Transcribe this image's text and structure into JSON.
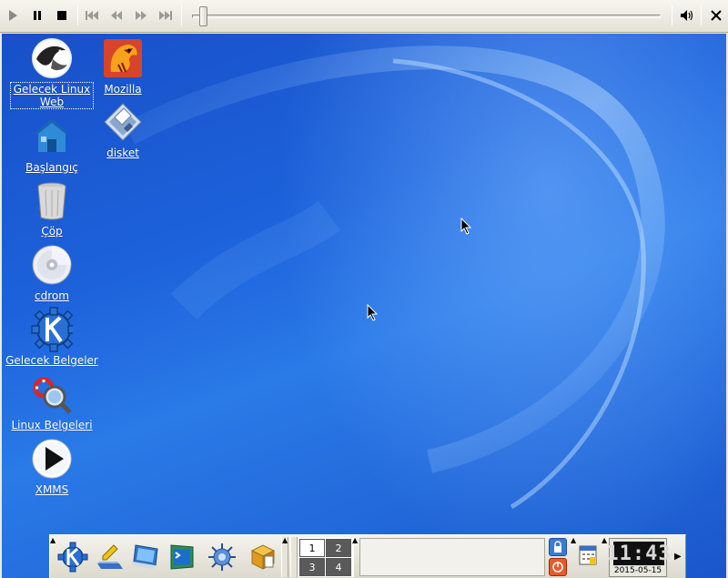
{
  "media_bar": {
    "buttons": [
      "play-icon",
      "pause-icon",
      "stop-icon",
      "skip-start-icon",
      "rewind-icon",
      "fast-forward-icon",
      "skip-end-icon"
    ],
    "seek_position": 0.02,
    "volume_icon": "speaker-icon",
    "close_icon": "close-icon"
  },
  "desktop": {
    "icons": [
      {
        "label": "Gelecek Linux Web",
        "icon": "eagle-icon",
        "selected": true
      },
      {
        "label": "Mozilla",
        "icon": "mozilla-icon"
      },
      {
        "label": "disket",
        "icon": "floppy-icon"
      },
      {
        "label": "Başlangıç",
        "icon": "home-icon"
      },
      {
        "label": "Çöp",
        "icon": "trash-icon"
      },
      {
        "label": "cdrom",
        "icon": "cdrom-icon"
      },
      {
        "label": "Gelecek Belgeler",
        "icon": "kde-gear-icon"
      },
      {
        "label": "Linux Belgeleri",
        "icon": "help-lifebuoy-icon"
      },
      {
        "label": "XMMS",
        "icon": "xmms-play-icon"
      }
    ],
    "background_color": "#1d62db"
  },
  "panel": {
    "launchers": [
      "kde-menu-icon",
      "editor-icon",
      "monitor-icon",
      "terminal-icon",
      "network-icon",
      "office-icon"
    ],
    "pager": [
      "1",
      "2",
      "3",
      "4"
    ],
    "active_desktop": "1",
    "clock": {
      "time": "11:43",
      "date": "2015-05-15"
    }
  }
}
